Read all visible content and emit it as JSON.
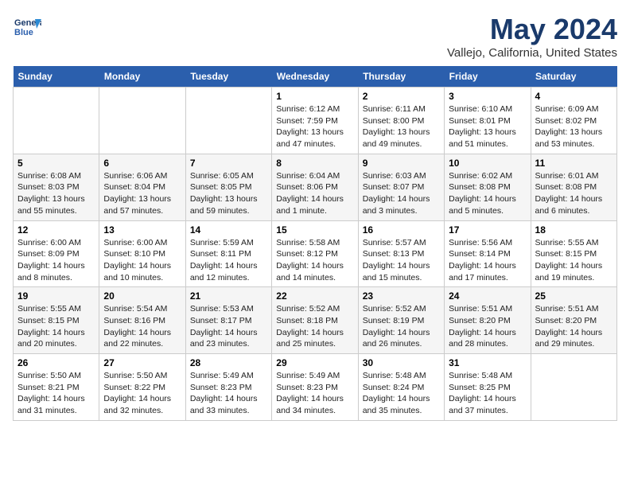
{
  "header": {
    "logo_line1": "General",
    "logo_line2": "Blue",
    "month": "May 2024",
    "location": "Vallejo, California, United States"
  },
  "weekdays": [
    "Sunday",
    "Monday",
    "Tuesday",
    "Wednesday",
    "Thursday",
    "Friday",
    "Saturday"
  ],
  "weeks": [
    [
      {
        "day": "",
        "info": ""
      },
      {
        "day": "",
        "info": ""
      },
      {
        "day": "",
        "info": ""
      },
      {
        "day": "1",
        "info": "Sunrise: 6:12 AM\nSunset: 7:59 PM\nDaylight: 13 hours\nand 47 minutes."
      },
      {
        "day": "2",
        "info": "Sunrise: 6:11 AM\nSunset: 8:00 PM\nDaylight: 13 hours\nand 49 minutes."
      },
      {
        "day": "3",
        "info": "Sunrise: 6:10 AM\nSunset: 8:01 PM\nDaylight: 13 hours\nand 51 minutes."
      },
      {
        "day": "4",
        "info": "Sunrise: 6:09 AM\nSunset: 8:02 PM\nDaylight: 13 hours\nand 53 minutes."
      }
    ],
    [
      {
        "day": "5",
        "info": "Sunrise: 6:08 AM\nSunset: 8:03 PM\nDaylight: 13 hours\nand 55 minutes."
      },
      {
        "day": "6",
        "info": "Sunrise: 6:06 AM\nSunset: 8:04 PM\nDaylight: 13 hours\nand 57 minutes."
      },
      {
        "day": "7",
        "info": "Sunrise: 6:05 AM\nSunset: 8:05 PM\nDaylight: 13 hours\nand 59 minutes."
      },
      {
        "day": "8",
        "info": "Sunrise: 6:04 AM\nSunset: 8:06 PM\nDaylight: 14 hours\nand 1 minute."
      },
      {
        "day": "9",
        "info": "Sunrise: 6:03 AM\nSunset: 8:07 PM\nDaylight: 14 hours\nand 3 minutes."
      },
      {
        "day": "10",
        "info": "Sunrise: 6:02 AM\nSunset: 8:08 PM\nDaylight: 14 hours\nand 5 minutes."
      },
      {
        "day": "11",
        "info": "Sunrise: 6:01 AM\nSunset: 8:08 PM\nDaylight: 14 hours\nand 6 minutes."
      }
    ],
    [
      {
        "day": "12",
        "info": "Sunrise: 6:00 AM\nSunset: 8:09 PM\nDaylight: 14 hours\nand 8 minutes."
      },
      {
        "day": "13",
        "info": "Sunrise: 6:00 AM\nSunset: 8:10 PM\nDaylight: 14 hours\nand 10 minutes."
      },
      {
        "day": "14",
        "info": "Sunrise: 5:59 AM\nSunset: 8:11 PM\nDaylight: 14 hours\nand 12 minutes."
      },
      {
        "day": "15",
        "info": "Sunrise: 5:58 AM\nSunset: 8:12 PM\nDaylight: 14 hours\nand 14 minutes."
      },
      {
        "day": "16",
        "info": "Sunrise: 5:57 AM\nSunset: 8:13 PM\nDaylight: 14 hours\nand 15 minutes."
      },
      {
        "day": "17",
        "info": "Sunrise: 5:56 AM\nSunset: 8:14 PM\nDaylight: 14 hours\nand 17 minutes."
      },
      {
        "day": "18",
        "info": "Sunrise: 5:55 AM\nSunset: 8:15 PM\nDaylight: 14 hours\nand 19 minutes."
      }
    ],
    [
      {
        "day": "19",
        "info": "Sunrise: 5:55 AM\nSunset: 8:15 PM\nDaylight: 14 hours\nand 20 minutes."
      },
      {
        "day": "20",
        "info": "Sunrise: 5:54 AM\nSunset: 8:16 PM\nDaylight: 14 hours\nand 22 minutes."
      },
      {
        "day": "21",
        "info": "Sunrise: 5:53 AM\nSunset: 8:17 PM\nDaylight: 14 hours\nand 23 minutes."
      },
      {
        "day": "22",
        "info": "Sunrise: 5:52 AM\nSunset: 8:18 PM\nDaylight: 14 hours\nand 25 minutes."
      },
      {
        "day": "23",
        "info": "Sunrise: 5:52 AM\nSunset: 8:19 PM\nDaylight: 14 hours\nand 26 minutes."
      },
      {
        "day": "24",
        "info": "Sunrise: 5:51 AM\nSunset: 8:20 PM\nDaylight: 14 hours\nand 28 minutes."
      },
      {
        "day": "25",
        "info": "Sunrise: 5:51 AM\nSunset: 8:20 PM\nDaylight: 14 hours\nand 29 minutes."
      }
    ],
    [
      {
        "day": "26",
        "info": "Sunrise: 5:50 AM\nSunset: 8:21 PM\nDaylight: 14 hours\nand 31 minutes."
      },
      {
        "day": "27",
        "info": "Sunrise: 5:50 AM\nSunset: 8:22 PM\nDaylight: 14 hours\nand 32 minutes."
      },
      {
        "day": "28",
        "info": "Sunrise: 5:49 AM\nSunset: 8:23 PM\nDaylight: 14 hours\nand 33 minutes."
      },
      {
        "day": "29",
        "info": "Sunrise: 5:49 AM\nSunset: 8:23 PM\nDaylight: 14 hours\nand 34 minutes."
      },
      {
        "day": "30",
        "info": "Sunrise: 5:48 AM\nSunset: 8:24 PM\nDaylight: 14 hours\nand 35 minutes."
      },
      {
        "day": "31",
        "info": "Sunrise: 5:48 AM\nSunset: 8:25 PM\nDaylight: 14 hours\nand 37 minutes."
      },
      {
        "day": "",
        "info": ""
      }
    ]
  ]
}
